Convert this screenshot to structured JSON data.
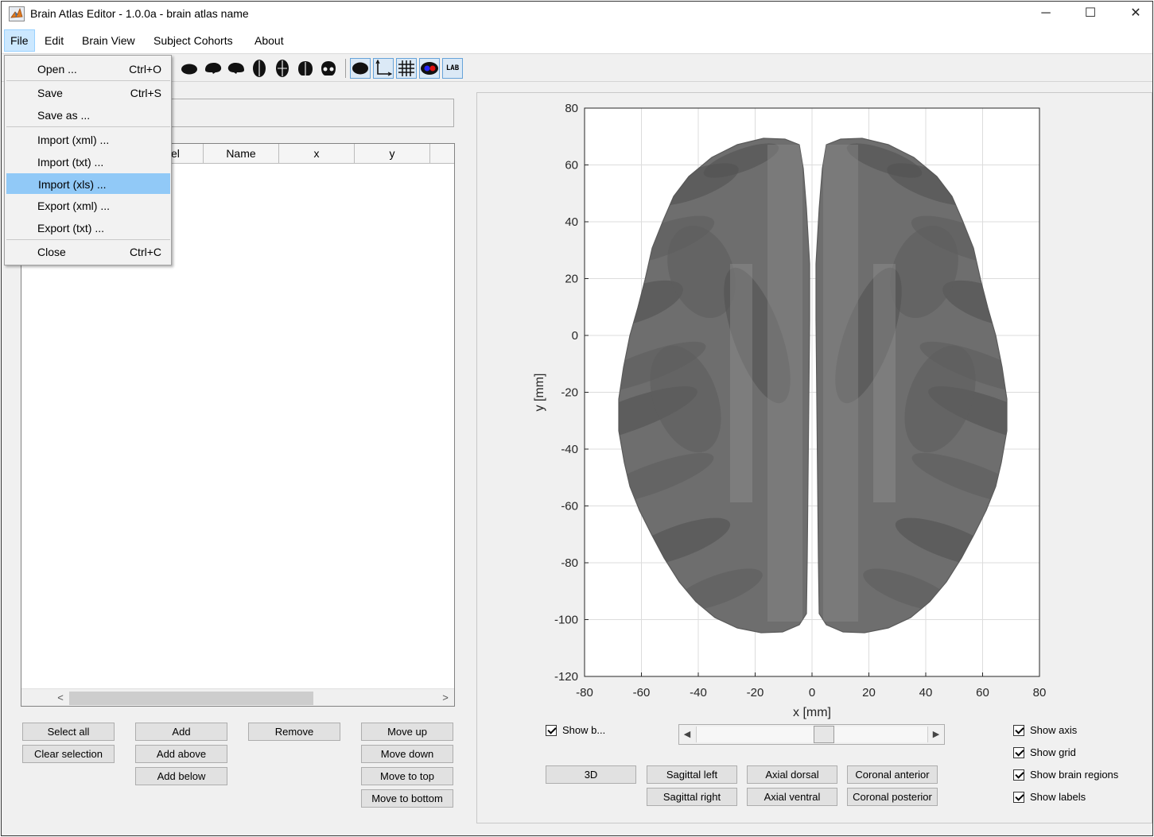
{
  "window": {
    "title": "Brain Atlas Editor - 1.0.0a - brain atlas name",
    "controls": {
      "minimize": "─",
      "maximize": "☐",
      "close": "✕"
    }
  },
  "menubar": {
    "file": "File",
    "edit": "Edit",
    "brain_view": "Brain View",
    "subject_cohorts": "Subject Cohorts",
    "about": "About"
  },
  "file_menu": {
    "open": {
      "label": "Open ...",
      "shortcut": "Ctrl+O"
    },
    "save": {
      "label": "Save",
      "shortcut": "Ctrl+S"
    },
    "save_as": {
      "label": "Save as ..."
    },
    "import_xml": {
      "label": "Import (xml) ..."
    },
    "import_txt": {
      "label": "Import (txt) ..."
    },
    "import_xls": {
      "label": "Import (xls) ..."
    },
    "export_xml": {
      "label": "Export (xml) ..."
    },
    "export_txt": {
      "label": "Export (txt) ..."
    },
    "close": {
      "label": "Close",
      "shortcut": "Ctrl+C"
    },
    "highlighted": "Import (xls) ..."
  },
  "toolbar": {
    "icons": [
      "brain-view-3d-icon",
      "sagittal-left-icon",
      "sagittal-right-icon",
      "axial-dorsal-icon",
      "axial-ventral-icon",
      "coronal-anterior-icon",
      "coronal-posterior-icon",
      "show-brain-icon",
      "show-axis-icon",
      "show-grid-icon",
      "show-regions-icon",
      "show-labels-icon"
    ],
    "lab_label": "LAB"
  },
  "table": {
    "columns": [
      "el",
      "Name",
      "x",
      "y"
    ],
    "scroll_left": "<",
    "scroll_right": ">"
  },
  "buttons": {
    "select_all": "Select all",
    "clear_selection": "Clear selection",
    "add": "Add",
    "add_above": "Add above",
    "add_below": "Add below",
    "remove": "Remove",
    "move_up": "Move up",
    "move_down": "Move down",
    "move_to_top": "Move to top",
    "move_to_bottom": "Move to bottom"
  },
  "plot": {
    "xlabel": "x [mm]",
    "ylabel": "y [mm]",
    "xlim": [
      -80,
      80
    ],
    "ylim": [
      -120,
      80
    ],
    "xticks": [
      -80,
      -60,
      -40,
      -20,
      0,
      20,
      40,
      60,
      80
    ],
    "yticks": [
      -120,
      -100,
      -80,
      -60,
      -40,
      -20,
      0,
      20,
      40,
      60,
      80
    ],
    "grid": true,
    "surface_color": "#6e6e6e"
  },
  "view_controls": {
    "show_brain": {
      "label": "Show b...",
      "checked": true
    },
    "view_3d": "3D",
    "sagittal_left": "Sagittal left",
    "sagittal_right": "Sagittal right",
    "axial_dorsal": "Axial dorsal",
    "axial_ventral": "Axial ventral",
    "coronal_anterior": "Coronal anterior",
    "coronal_posterior": "Coronal posterior",
    "show_axis": {
      "label": "Show axis",
      "checked": true
    },
    "show_grid": {
      "label": "Show grid",
      "checked": true
    },
    "show_brain_regions": {
      "label": "Show brain regions",
      "checked": true
    },
    "show_labels": {
      "label": "Show labels",
      "checked": true
    },
    "slider": {
      "left_arrow": "◀",
      "right_arrow": "▶",
      "value": 0.5
    }
  }
}
